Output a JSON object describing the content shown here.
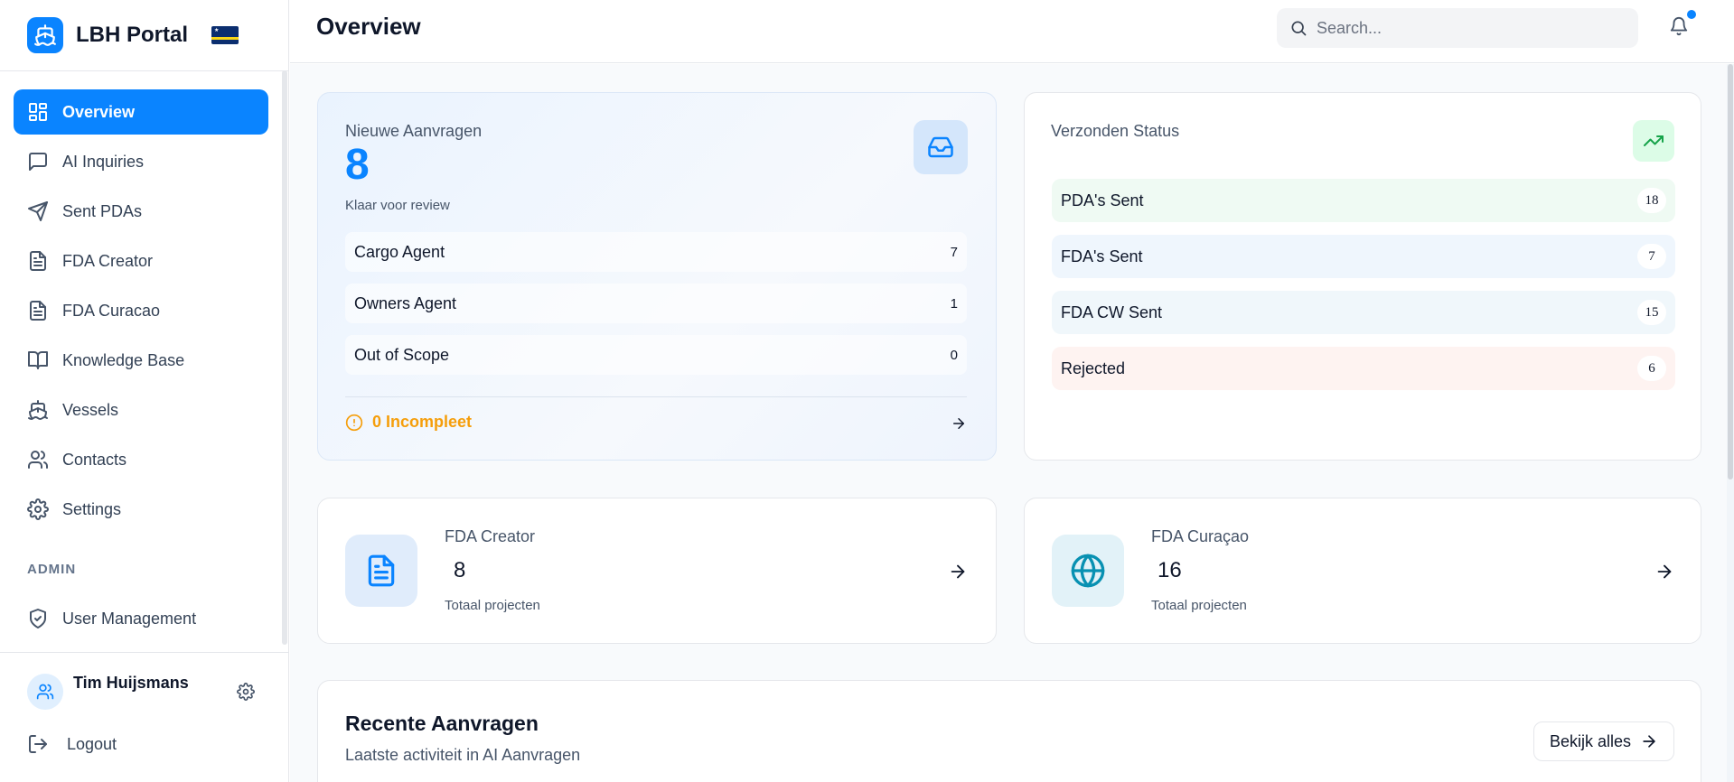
{
  "brand": {
    "title": "LBH Portal",
    "logo_icon": "ship-icon",
    "flag": "curacao-flag"
  },
  "sidebar": {
    "items": [
      {
        "label": "Overview",
        "icon": "layout-grid-icon",
        "active": true
      },
      {
        "label": "AI Inquiries",
        "icon": "message-square-icon"
      },
      {
        "label": "Sent PDAs",
        "icon": "send-icon"
      },
      {
        "label": "FDA Creator",
        "icon": "file-text-icon"
      },
      {
        "label": "FDA Curacao",
        "icon": "file-text-icon"
      },
      {
        "label": "Knowledge Base",
        "icon": "book-open-icon"
      },
      {
        "label": "Vessels",
        "icon": "ship-icon"
      },
      {
        "label": "Contacts",
        "icon": "users-icon"
      },
      {
        "label": "Settings",
        "icon": "settings-icon"
      }
    ],
    "admin_label": "ADMIN",
    "admin_items": [
      {
        "label": "User Management",
        "icon": "shield-check-icon"
      }
    ],
    "user": {
      "name": "Tim Huijsmans"
    },
    "logout_label": "Logout"
  },
  "header": {
    "title": "Overview",
    "search_placeholder": "Search...",
    "notification_dot": true
  },
  "new_requests": {
    "label": "Nieuwe Aanvragen",
    "count": "8",
    "sub": "Klaar voor review",
    "rows": [
      {
        "label": "Cargo Agent",
        "count": "7"
      },
      {
        "label": "Owners Agent",
        "count": "1"
      },
      {
        "label": "Out of Scope",
        "count": "0"
      }
    ],
    "incomplete_label": "0 Incompleet"
  },
  "sent_status": {
    "label": "Verzonden Status",
    "rows": [
      {
        "label": "PDA's Sent",
        "count": "18",
        "bg": "#effaf3"
      },
      {
        "label": "FDA's Sent",
        "count": "7",
        "bg": "#eff6fd"
      },
      {
        "label": "FDA CW Sent",
        "count": "15",
        "bg": "#f0f7fb"
      },
      {
        "label": "Rejected",
        "count": "6",
        "bg": "#fef3f1"
      }
    ]
  },
  "fda_creator": {
    "label": "FDA Creator",
    "count": "8",
    "sub": "Totaal projecten"
  },
  "fda_curacao": {
    "label": "FDA Curaçao",
    "count": "16",
    "sub": "Totaal projecten"
  },
  "recent": {
    "title": "Recente Aanvragen",
    "sub": "Laatste activiteit in AI Aanvragen",
    "view_all_label": "Bekijk alles"
  },
  "colors": {
    "accent": "#0a84ff",
    "warning": "#f59e0b",
    "success": "#16a34a",
    "cyan": "#0891b2"
  }
}
